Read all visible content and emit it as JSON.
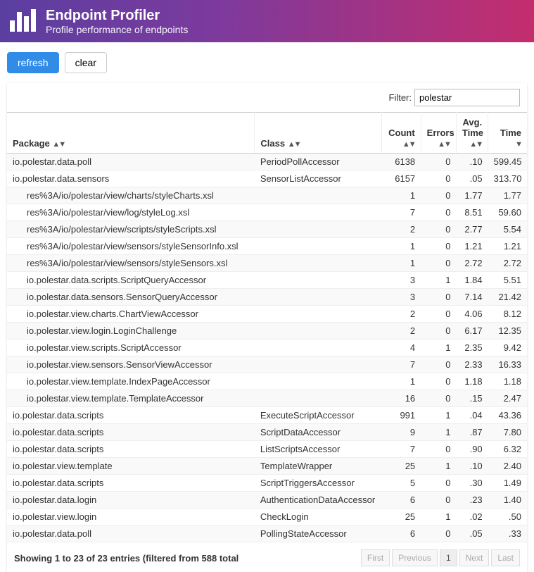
{
  "header": {
    "title": "Endpoint Profiler",
    "subtitle": "Profile performance of endpoints"
  },
  "toolbar": {
    "refresh": "refresh",
    "clear": "clear"
  },
  "filter": {
    "label": "Filter:",
    "value": "polestar"
  },
  "columns": {
    "package": "Package",
    "class": "Class",
    "count": "Count",
    "errors": "Errors",
    "avg_time": "Avg. Time",
    "time": "Time"
  },
  "rows": [
    {
      "package": "io.polestar.data.poll",
      "class": "PeriodPollAccessor",
      "count": "6138",
      "errors": "0",
      "avg": ".10",
      "time": "599.45",
      "indent": false
    },
    {
      "package": "io.polestar.data.sensors",
      "class": "SensorListAccessor",
      "count": "6157",
      "errors": "0",
      "avg": ".05",
      "time": "313.70",
      "indent": false
    },
    {
      "package": "res%3A/io/polestar/view/charts/styleCharts.xsl",
      "class": "",
      "count": "1",
      "errors": "0",
      "avg": "1.77",
      "time": "1.77",
      "indent": true
    },
    {
      "package": "res%3A/io/polestar/view/log/styleLog.xsl",
      "class": "",
      "count": "7",
      "errors": "0",
      "avg": "8.51",
      "time": "59.60",
      "indent": true
    },
    {
      "package": "res%3A/io/polestar/view/scripts/styleScripts.xsl",
      "class": "",
      "count": "2",
      "errors": "0",
      "avg": "2.77",
      "time": "5.54",
      "indent": true
    },
    {
      "package": "res%3A/io/polestar/view/sensors/styleSensorInfo.xsl",
      "class": "",
      "count": "1",
      "errors": "0",
      "avg": "1.21",
      "time": "1.21",
      "indent": true
    },
    {
      "package": "res%3A/io/polestar/view/sensors/styleSensors.xsl",
      "class": "",
      "count": "1",
      "errors": "0",
      "avg": "2.72",
      "time": "2.72",
      "indent": true
    },
    {
      "package": "io.polestar.data.scripts.ScriptQueryAccessor",
      "class": "",
      "count": "3",
      "errors": "1",
      "avg": "1.84",
      "time": "5.51",
      "indent": true
    },
    {
      "package": "io.polestar.data.sensors.SensorQueryAccessor",
      "class": "",
      "count": "3",
      "errors": "0",
      "avg": "7.14",
      "time": "21.42",
      "indent": true
    },
    {
      "package": "io.polestar.view.charts.ChartViewAccessor",
      "class": "",
      "count": "2",
      "errors": "0",
      "avg": "4.06",
      "time": "8.12",
      "indent": true
    },
    {
      "package": "io.polestar.view.login.LoginChallenge",
      "class": "",
      "count": "2",
      "errors": "0",
      "avg": "6.17",
      "time": "12.35",
      "indent": true
    },
    {
      "package": "io.polestar.view.scripts.ScriptAccessor",
      "class": "",
      "count": "4",
      "errors": "1",
      "avg": "2.35",
      "time": "9.42",
      "indent": true
    },
    {
      "package": "io.polestar.view.sensors.SensorViewAccessor",
      "class": "",
      "count": "7",
      "errors": "0",
      "avg": "2.33",
      "time": "16.33",
      "indent": true
    },
    {
      "package": "io.polestar.view.template.IndexPageAccessor",
      "class": "",
      "count": "1",
      "errors": "0",
      "avg": "1.18",
      "time": "1.18",
      "indent": true
    },
    {
      "package": "io.polestar.view.template.TemplateAccessor",
      "class": "",
      "count": "16",
      "errors": "0",
      "avg": ".15",
      "time": "2.47",
      "indent": true
    },
    {
      "package": "io.polestar.data.scripts",
      "class": "ExecuteScriptAccessor",
      "count": "991",
      "errors": "1",
      "avg": ".04",
      "time": "43.36",
      "indent": false
    },
    {
      "package": "io.polestar.data.scripts",
      "class": "ScriptDataAccessor",
      "count": "9",
      "errors": "1",
      "avg": ".87",
      "time": "7.80",
      "indent": false
    },
    {
      "package": "io.polestar.data.scripts",
      "class": "ListScriptsAccessor",
      "count": "7",
      "errors": "0",
      "avg": ".90",
      "time": "6.32",
      "indent": false
    },
    {
      "package": "io.polestar.view.template",
      "class": "TemplateWrapper",
      "count": "25",
      "errors": "1",
      "avg": ".10",
      "time": "2.40",
      "indent": false
    },
    {
      "package": "io.polestar.data.scripts",
      "class": "ScriptTriggersAccessor",
      "count": "5",
      "errors": "0",
      "avg": ".30",
      "time": "1.49",
      "indent": false
    },
    {
      "package": "io.polestar.data.login",
      "class": "AuthenticationDataAccessor",
      "count": "6",
      "errors": "0",
      "avg": ".23",
      "time": "1.40",
      "indent": false
    },
    {
      "package": "io.polestar.view.login",
      "class": "CheckLogin",
      "count": "25",
      "errors": "1",
      "avg": ".02",
      "time": ".50",
      "indent": false
    },
    {
      "package": "io.polestar.data.poll",
      "class": "PollingStateAccessor",
      "count": "6",
      "errors": "0",
      "avg": ".05",
      "time": ".33",
      "indent": false
    }
  ],
  "footer": {
    "info": "Showing 1 to 23 of 23 entries (filtered from 588 total"
  },
  "pagination": {
    "first": "First",
    "previous": "Previous",
    "current": "1",
    "next": "Next",
    "last": "Last"
  }
}
